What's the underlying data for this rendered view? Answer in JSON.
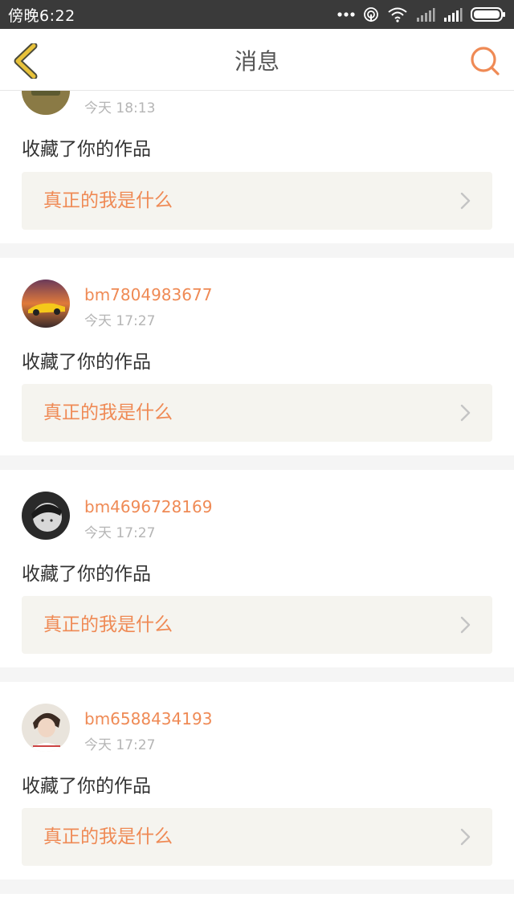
{
  "status_bar": {
    "time": "傍晚6:22",
    "icons": [
      "more-dots-icon",
      "hotspot-icon",
      "wifi-icon",
      "signal-icon",
      "signal-icon",
      "battery-icon"
    ]
  },
  "nav": {
    "title": "消息",
    "back_icon": "chevron-left-icon",
    "search_icon": "search-icon",
    "accent_color": "#ef8a55",
    "back_color": "#e8c23a"
  },
  "messages": [
    {
      "username": "",
      "time": "今天 18:13",
      "action": "收藏了你的作品",
      "work_title": "真正的我是什么"
    },
    {
      "username": "bm7804983677",
      "time": "今天 17:27",
      "action": "收藏了你的作品",
      "work_title": "真正的我是什么"
    },
    {
      "username": "bm4696728169",
      "time": "今天 17:27",
      "action": "收藏了你的作品",
      "work_title": "真正的我是什么"
    },
    {
      "username": "bm6588434193",
      "time": "今天 17:27",
      "action": "收藏了你的作品",
      "work_title": "真正的我是什么"
    }
  ]
}
